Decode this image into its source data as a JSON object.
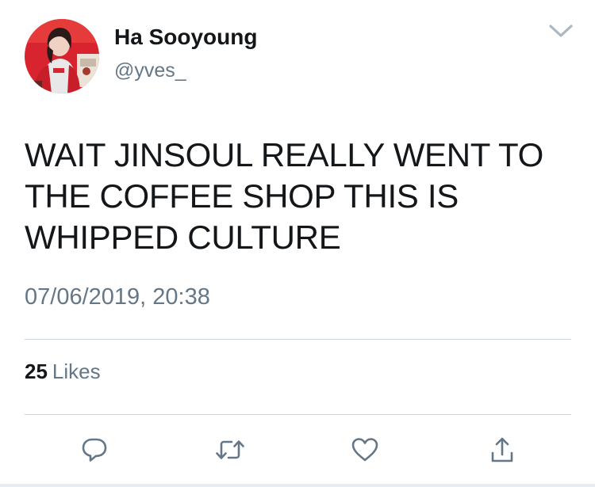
{
  "user": {
    "display_name": "Ha Sooyoung",
    "handle": "@yves_"
  },
  "tweet": {
    "text": "WAIT JINSOUL REALLY WENT TO THE COFFEE SHOP THIS IS WHIPPED CULTURE",
    "timestamp": "07/06/2019, 20:38"
  },
  "stats": {
    "likes_count": "25",
    "likes_label": "Likes"
  },
  "icons": {
    "caret": "chevron-down-icon",
    "reply": "reply-icon",
    "retweet": "retweet-icon",
    "like": "heart-icon",
    "share": "share-icon"
  },
  "colors": {
    "primary_text": "#14171a",
    "secondary_text": "#657786",
    "divider": "#ccd6dd",
    "avatar_accent": "#d8242f"
  }
}
